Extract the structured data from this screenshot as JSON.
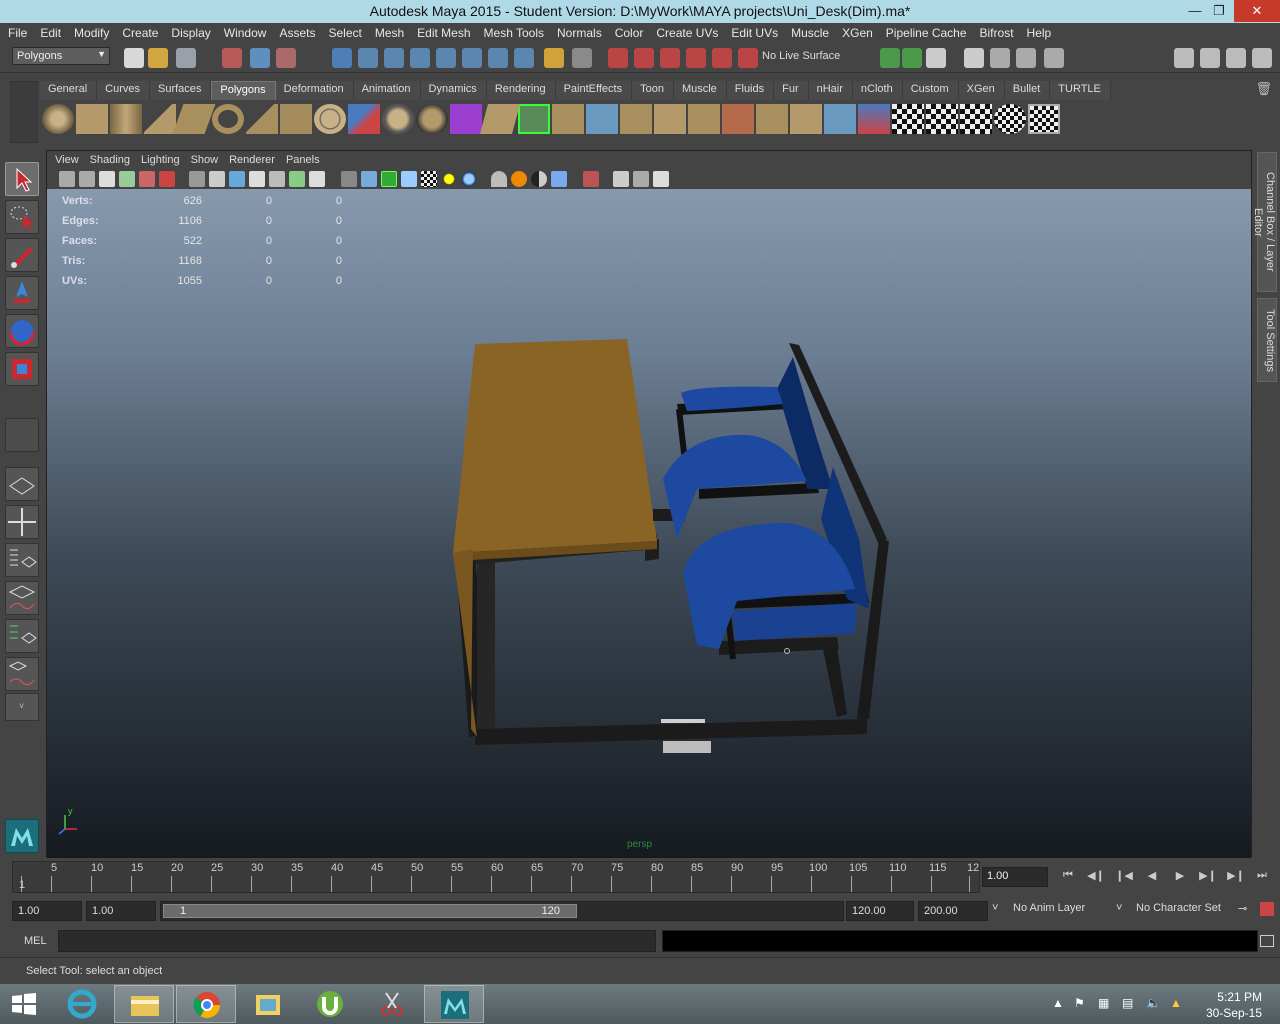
{
  "window": {
    "title": "Autodesk Maya 2015 - Student Version: D:\\MyWork\\MAYA projects\\Uni_Desk(Dim).ma*"
  },
  "menus": [
    "File",
    "Edit",
    "Modify",
    "Create",
    "Display",
    "Window",
    "Assets",
    "Select",
    "Mesh",
    "Edit Mesh",
    "Mesh Tools",
    "Normals",
    "Color",
    "Create UVs",
    "Edit UVs",
    "Muscle",
    "XGen",
    "Pipeline Cache",
    "Bifrost",
    "Help"
  ],
  "status_line": {
    "mode": "Polygons",
    "live_surface": "No Live Surface"
  },
  "shelf_tabs": [
    "General",
    "Curves",
    "Surfaces",
    "Polygons",
    "Deformation",
    "Animation",
    "Dynamics",
    "Rendering",
    "PaintEffects",
    "Toon",
    "Muscle",
    "Fluids",
    "Fur",
    "nHair",
    "nCloth",
    "Custom",
    "XGen",
    "Bullet",
    "TURTLE"
  ],
  "shelf_active": "Polygons",
  "panel_menus": [
    "View",
    "Shading",
    "Lighting",
    "Show",
    "Renderer",
    "Panels"
  ],
  "hud": {
    "rows": [
      {
        "label": "Verts:",
        "a": "626",
        "b": "0",
        "c": "0"
      },
      {
        "label": "Edges:",
        "a": "1106",
        "b": "0",
        "c": "0"
      },
      {
        "label": "Faces:",
        "a": "522",
        "b": "0",
        "c": "0"
      },
      {
        "label": "Tris:",
        "a": "1168",
        "b": "0",
        "c": "0"
      },
      {
        "label": "UVs:",
        "a": "1055",
        "b": "0",
        "c": "0"
      }
    ]
  },
  "viewport": {
    "camera": "persp",
    "axis_y": "y"
  },
  "side_tabs": {
    "channel_box": "Channel Box / Layer Editor",
    "tool_settings": "Tool Settings"
  },
  "time_slider": {
    "start_label": "1",
    "ticks": [
      "5",
      "10",
      "15",
      "20",
      "25",
      "30",
      "35",
      "40",
      "45",
      "50",
      "55",
      "60",
      "65",
      "70",
      "75",
      "80",
      "85",
      "90",
      "95",
      "100",
      "105",
      "110",
      "115",
      "12"
    ],
    "current_frame": "1.00"
  },
  "range": {
    "start": "1.00",
    "playback_start": "1.00",
    "slider_start": "1",
    "slider_end": "120",
    "playback_end": "120.00",
    "end": "200.00",
    "anim_layer": "No Anim Layer",
    "character_set": "No Character Set"
  },
  "command_line": {
    "label": "MEL"
  },
  "help_line": {
    "text": "Select Tool: select an object"
  },
  "taskbar": {
    "time": "5:21 PM",
    "date": "30-Sep-15"
  },
  "colors": {
    "desk_top": "#8a6425",
    "chair_blue": "#1d4aa0",
    "viewport_top": "#8799ad"
  }
}
